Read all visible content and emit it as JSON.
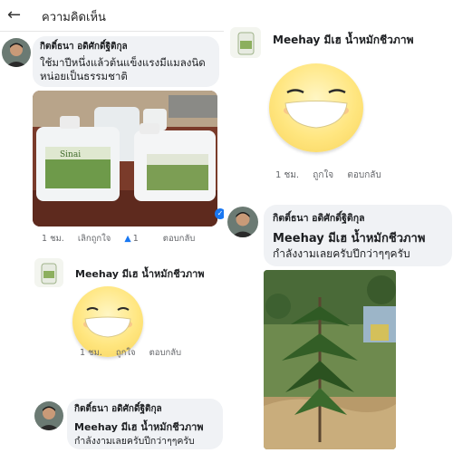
{
  "header": {
    "back_icon": "arrow-left-icon",
    "title": "ความคิดเห็น"
  },
  "comments_left": [
    {
      "author": "กิตติ์ธนา อดิศักดิ์ฐิติกุล",
      "text_line1": "ใช้มาปีหนึ่งแล้วต้นแข็งแรงมีแมลงนิด",
      "text_line2": "หน่อยเป็นธรรมชาติ",
      "photo_icon": "fertilizer-jugs-photo",
      "jug_label": "Sinai",
      "time": "1 ชม.",
      "unlike": "เลิกถูกใจ",
      "like_count": "1",
      "reply": "ตอบกลับ"
    },
    {
      "author": "Meehay มีเฮ น้ำหมักชีวภาพ",
      "sticker": "grinning-face-sticker",
      "time": "1 ชม.",
      "like": "ถูกใจ",
      "reply": "ตอบกลับ"
    },
    {
      "author": "กิตติ์ธนา อดิศักดิ์ฐิติกุล",
      "text_line1": "Meehay มีเฮ น้ำหมักชีวภาพ",
      "text_line2": "กำลังงามเลยครับปีกว่าๆๆครับ"
    }
  ],
  "comments_right": [
    {
      "author": "Meehay มีเฮ น้ำหมักชีวภาพ",
      "sticker": "grinning-face-sticker",
      "time": "1 ชม.",
      "like": "ถูกใจ",
      "reply": "ตอบกลับ"
    },
    {
      "author": "กิตติ์ธนา อดิศักดิ์ฐิติกุล",
      "text_line1": "Meehay มีเฮ น้ำหมักชีวภาพ",
      "text_line2": "กำลังงามเลยครับปีกว่าๆๆครับ",
      "photo_icon": "durian-tree-photo"
    }
  ],
  "colors": {
    "bubble": "#f0f2f5",
    "accent": "#1877f2",
    "meta": "#65676b"
  }
}
